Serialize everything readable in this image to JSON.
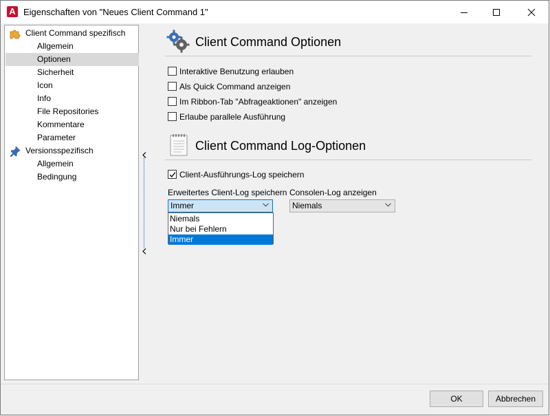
{
  "window": {
    "title": "Eigenschaften von \"Neues Client Command 1\"",
    "icon": "app-logo-icon",
    "accent": "#c8102e"
  },
  "sidebar": {
    "items": [
      {
        "label": "Client Command spezifisch",
        "level": 0,
        "icon": "puzzle-icon"
      },
      {
        "label": "Allgemein",
        "level": 1
      },
      {
        "label": "Optionen",
        "level": 1,
        "selected": true
      },
      {
        "label": "Sicherheit",
        "level": 1
      },
      {
        "label": "Icon",
        "level": 1
      },
      {
        "label": "Info",
        "level": 1
      },
      {
        "label": "File Repositories",
        "level": 1
      },
      {
        "label": "Kommentare",
        "level": 1
      },
      {
        "label": "Parameter",
        "level": 1
      },
      {
        "label": "Versionsspezifisch",
        "level": 0,
        "icon": "pin-icon"
      },
      {
        "label": "Allgemein",
        "level": 1
      },
      {
        "label": "Bedingung",
        "level": 1
      }
    ]
  },
  "options": {
    "title": "Client Command Optionen",
    "icon": "gears-icon",
    "checkboxes": [
      {
        "label": "Interaktive Benutzung erlauben",
        "checked": false
      },
      {
        "label": "Als Quick Command anzeigen",
        "checked": false
      },
      {
        "label": "Im Ribbon-Tab \"Abfrageaktionen\" anzeigen",
        "checked": false
      },
      {
        "label": "Erlaube parallele Ausführung",
        "checked": false
      }
    ]
  },
  "log": {
    "title": "Client Command Log-Optionen",
    "icon": "notepad-icon",
    "save_log": {
      "label": "Client-Ausführungs-Log speichern",
      "checked": true
    },
    "extended_log": {
      "label": "Erweitertes Client-Log speichern",
      "value": "Immer",
      "options": [
        "Niemals",
        "Nur bei Fehlern",
        "Immer"
      ],
      "selected_index": 2,
      "open": true
    },
    "console_log": {
      "label": "Consolen-Log anzeigen",
      "value": "Niemals"
    }
  },
  "footer": {
    "ok_label": "OK",
    "cancel_label": "Abbrechen"
  }
}
